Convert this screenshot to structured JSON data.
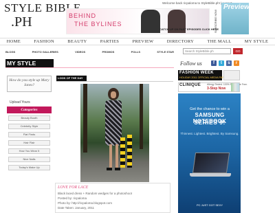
{
  "logo": {
    "line1": "STYLE BIBLE",
    "line2": ".PH"
  },
  "header": {
    "welcome_text": "Welcome back ricpaloma to StyleBible.ph! | Logout",
    "banner_title_1": "BEHIND",
    "banner_title_2": "THE BYLINES",
    "banner_cta": "CATCH UP ON PAST EPISODES CLICK HERE",
    "subscribe_label": "SUBSCRIBE NOW",
    "magazine_title": "Preview"
  },
  "nav": {
    "items": [
      "HOME",
      "FASHION",
      "BEAUTY",
      "PARTIES",
      "PREVIEW",
      "DIRECTORY",
      "THE MALL",
      "MY STYLE"
    ]
  },
  "subnav": {
    "items": [
      "BLOGS",
      "PHOTO GALLERIES",
      "VIDEOS",
      "PROMOS",
      "POLLS",
      "STYLE STAR"
    ]
  },
  "search": {
    "placeholder": "Search StyleBible.ph",
    "button_label": "GO"
  },
  "section": {
    "title": "MY STYLE",
    "look_label": "LOOK OF THE DAY"
  },
  "sidebar": {
    "ask_text": "How do you style up Mary Janes?",
    "upload_label": "Upload Yours",
    "categories_label": "Categories",
    "categories": [
      "Beauty Booth",
      "Celebrity Style",
      "Flat Finds",
      "Hair Flair",
      "How You Wear It",
      "Nice Nails",
      "Today's Make Up"
    ]
  },
  "post": {
    "title": "LOVE FOR LACE",
    "description": "Black laced dress + Random wedges for a photoshoot",
    "posted_by": "Posted by: ricpaloma",
    "photo_by": "Photo by: http://ricpaloma.blogspot.com",
    "date_taken": "Date Taken: January, 2011"
  },
  "right": {
    "follow_label": "Follow us",
    "fashion_week": "FASHION WEEK",
    "fashion_week_sub": "HOLIDAY 2011 OFFICIAL MEDIA PARTNER",
    "clinique_name": "CLINIQUE",
    "clinique_tagline": "Allergy Tested. 100% Fragrance Free.",
    "clinique_step": "3-Step Now",
    "samsung_line1": "Get the chance to win a",
    "samsung_line2": "SAMSUNG NOTEBOOK",
    "samsung_line3": "SERIES 9!",
    "samsung_tagline": "Thinnest. Lightest. Brightest. By Samsung.",
    "samsung_footer": "PC JUST GOT SEXY"
  },
  "colors": {
    "brand_pink": "#d43b6b",
    "category_header": "#c2185b",
    "go_button": "#c0272d",
    "samsung_blue": "#1d67a6"
  }
}
